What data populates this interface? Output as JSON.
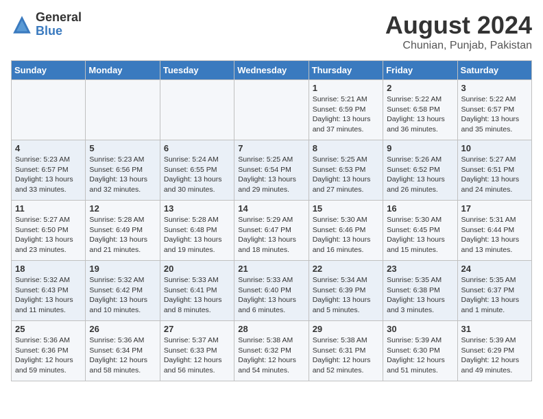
{
  "logo": {
    "general": "General",
    "blue": "Blue"
  },
  "title": "August 2024",
  "location": "Chunian, Punjab, Pakistan",
  "days_of_week": [
    "Sunday",
    "Monday",
    "Tuesday",
    "Wednesday",
    "Thursday",
    "Friday",
    "Saturday"
  ],
  "weeks": [
    [
      {
        "day": "",
        "lines": []
      },
      {
        "day": "",
        "lines": []
      },
      {
        "day": "",
        "lines": []
      },
      {
        "day": "",
        "lines": []
      },
      {
        "day": "1",
        "lines": [
          "Sunrise: 5:21 AM",
          "Sunset: 6:59 PM",
          "Daylight: 13 hours",
          "and 37 minutes."
        ]
      },
      {
        "day": "2",
        "lines": [
          "Sunrise: 5:22 AM",
          "Sunset: 6:58 PM",
          "Daylight: 13 hours",
          "and 36 minutes."
        ]
      },
      {
        "day": "3",
        "lines": [
          "Sunrise: 5:22 AM",
          "Sunset: 6:57 PM",
          "Daylight: 13 hours",
          "and 35 minutes."
        ]
      }
    ],
    [
      {
        "day": "4",
        "lines": [
          "Sunrise: 5:23 AM",
          "Sunset: 6:57 PM",
          "Daylight: 13 hours",
          "and 33 minutes."
        ]
      },
      {
        "day": "5",
        "lines": [
          "Sunrise: 5:23 AM",
          "Sunset: 6:56 PM",
          "Daylight: 13 hours",
          "and 32 minutes."
        ]
      },
      {
        "day": "6",
        "lines": [
          "Sunrise: 5:24 AM",
          "Sunset: 6:55 PM",
          "Daylight: 13 hours",
          "and 30 minutes."
        ]
      },
      {
        "day": "7",
        "lines": [
          "Sunrise: 5:25 AM",
          "Sunset: 6:54 PM",
          "Daylight: 13 hours",
          "and 29 minutes."
        ]
      },
      {
        "day": "8",
        "lines": [
          "Sunrise: 5:25 AM",
          "Sunset: 6:53 PM",
          "Daylight: 13 hours",
          "and 27 minutes."
        ]
      },
      {
        "day": "9",
        "lines": [
          "Sunrise: 5:26 AM",
          "Sunset: 6:52 PM",
          "Daylight: 13 hours",
          "and 26 minutes."
        ]
      },
      {
        "day": "10",
        "lines": [
          "Sunrise: 5:27 AM",
          "Sunset: 6:51 PM",
          "Daylight: 13 hours",
          "and 24 minutes."
        ]
      }
    ],
    [
      {
        "day": "11",
        "lines": [
          "Sunrise: 5:27 AM",
          "Sunset: 6:50 PM",
          "Daylight: 13 hours",
          "and 23 minutes."
        ]
      },
      {
        "day": "12",
        "lines": [
          "Sunrise: 5:28 AM",
          "Sunset: 6:49 PM",
          "Daylight: 13 hours",
          "and 21 minutes."
        ]
      },
      {
        "day": "13",
        "lines": [
          "Sunrise: 5:28 AM",
          "Sunset: 6:48 PM",
          "Daylight: 13 hours",
          "and 19 minutes."
        ]
      },
      {
        "day": "14",
        "lines": [
          "Sunrise: 5:29 AM",
          "Sunset: 6:47 PM",
          "Daylight: 13 hours",
          "and 18 minutes."
        ]
      },
      {
        "day": "15",
        "lines": [
          "Sunrise: 5:30 AM",
          "Sunset: 6:46 PM",
          "Daylight: 13 hours",
          "and 16 minutes."
        ]
      },
      {
        "day": "16",
        "lines": [
          "Sunrise: 5:30 AM",
          "Sunset: 6:45 PM",
          "Daylight: 13 hours",
          "and 15 minutes."
        ]
      },
      {
        "day": "17",
        "lines": [
          "Sunrise: 5:31 AM",
          "Sunset: 6:44 PM",
          "Daylight: 13 hours",
          "and 13 minutes."
        ]
      }
    ],
    [
      {
        "day": "18",
        "lines": [
          "Sunrise: 5:32 AM",
          "Sunset: 6:43 PM",
          "Daylight: 13 hours",
          "and 11 minutes."
        ]
      },
      {
        "day": "19",
        "lines": [
          "Sunrise: 5:32 AM",
          "Sunset: 6:42 PM",
          "Daylight: 13 hours",
          "and 10 minutes."
        ]
      },
      {
        "day": "20",
        "lines": [
          "Sunrise: 5:33 AM",
          "Sunset: 6:41 PM",
          "Daylight: 13 hours",
          "and 8 minutes."
        ]
      },
      {
        "day": "21",
        "lines": [
          "Sunrise: 5:33 AM",
          "Sunset: 6:40 PM",
          "Daylight: 13 hours",
          "and 6 minutes."
        ]
      },
      {
        "day": "22",
        "lines": [
          "Sunrise: 5:34 AM",
          "Sunset: 6:39 PM",
          "Daylight: 13 hours",
          "and 5 minutes."
        ]
      },
      {
        "day": "23",
        "lines": [
          "Sunrise: 5:35 AM",
          "Sunset: 6:38 PM",
          "Daylight: 13 hours",
          "and 3 minutes."
        ]
      },
      {
        "day": "24",
        "lines": [
          "Sunrise: 5:35 AM",
          "Sunset: 6:37 PM",
          "Daylight: 13 hours",
          "and 1 minute."
        ]
      }
    ],
    [
      {
        "day": "25",
        "lines": [
          "Sunrise: 5:36 AM",
          "Sunset: 6:36 PM",
          "Daylight: 12 hours",
          "and 59 minutes."
        ]
      },
      {
        "day": "26",
        "lines": [
          "Sunrise: 5:36 AM",
          "Sunset: 6:34 PM",
          "Daylight: 12 hours",
          "and 58 minutes."
        ]
      },
      {
        "day": "27",
        "lines": [
          "Sunrise: 5:37 AM",
          "Sunset: 6:33 PM",
          "Daylight: 12 hours",
          "and 56 minutes."
        ]
      },
      {
        "day": "28",
        "lines": [
          "Sunrise: 5:38 AM",
          "Sunset: 6:32 PM",
          "Daylight: 12 hours",
          "and 54 minutes."
        ]
      },
      {
        "day": "29",
        "lines": [
          "Sunrise: 5:38 AM",
          "Sunset: 6:31 PM",
          "Daylight: 12 hours",
          "and 52 minutes."
        ]
      },
      {
        "day": "30",
        "lines": [
          "Sunrise: 5:39 AM",
          "Sunset: 6:30 PM",
          "Daylight: 12 hours",
          "and 51 minutes."
        ]
      },
      {
        "day": "31",
        "lines": [
          "Sunrise: 5:39 AM",
          "Sunset: 6:29 PM",
          "Daylight: 12 hours",
          "and 49 minutes."
        ]
      }
    ]
  ]
}
